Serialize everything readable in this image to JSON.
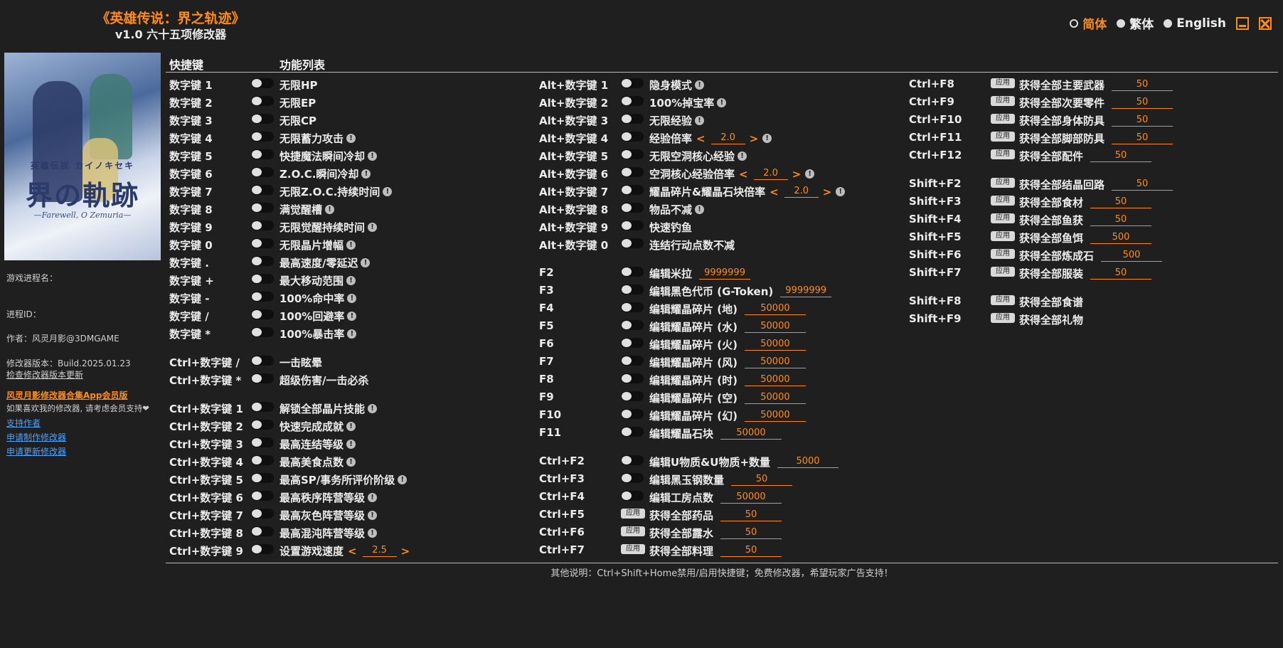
{
  "title": {
    "game": "《英雄传说：界之轨迹》",
    "version": "v1.0 六十五项修改器"
  },
  "languages": [
    {
      "label": "简体",
      "active": true
    },
    {
      "label": "繁体",
      "active": false
    },
    {
      "label": "English",
      "active": false
    }
  ],
  "cover": {
    "logo": "界の軌跡",
    "top": "英雄伝説 カイノキセキ",
    "subtitle": "—Farewell, O Zemuria—"
  },
  "sidebar": {
    "process_name_label": "游戏进程名：",
    "process_id_label": "进程ID：",
    "author": "作者：风灵月影@3DMGAME",
    "version": "修改器版本：Build.2025.01.23",
    "check_update": "检查修改器版本更新",
    "vip": "风灵月影修改器合集App会员版",
    "support_text": "如果喜欢我的修改器, 请考虑会员支持❤",
    "support_author": "支持作者",
    "request_make": "申请制作修改器",
    "request_update": "申请更新修改器"
  },
  "headers": {
    "hotkey": "快捷键",
    "features": "功能列表"
  },
  "col1": [
    {
      "key": "数字键 1",
      "label": "无限HP",
      "warn": false
    },
    {
      "key": "数字键 2",
      "label": "无限EP",
      "warn": false
    },
    {
      "key": "数字键 3",
      "label": "无限CP",
      "warn": false
    },
    {
      "key": "数字键 4",
      "label": "无限蓄力攻击",
      "warn": true
    },
    {
      "key": "数字键 5",
      "label": "快捷魔法瞬间冷却",
      "warn": true
    },
    {
      "key": "数字键 6",
      "label": "Z.O.C.瞬间冷却",
      "warn": true
    },
    {
      "key": "数字键 7",
      "label": "无限Z.O.C.持续时间",
      "warn": true
    },
    {
      "key": "数字键 8",
      "label": "满觉醒槽",
      "warn": true
    },
    {
      "key": "数字键 9",
      "label": "无限觉醒持续时间",
      "warn": true
    },
    {
      "key": "数字键 0",
      "label": "无限晶片增幅",
      "warn": true
    },
    {
      "key": "数字键 .",
      "label": "最高速度/零延迟",
      "warn": true
    },
    {
      "key": "数字键 +",
      "label": "最大移动范围",
      "warn": true
    },
    {
      "key": "数字键 -",
      "label": "100%命中率",
      "warn": true
    },
    {
      "key": "数字键 /",
      "label": "100%回避率",
      "warn": true
    },
    {
      "key": "数字键 *",
      "label": "100%暴击率",
      "warn": true
    },
    {
      "key": "Ctrl+数字键 /",
      "label": "一击眩晕",
      "warn": false,
      "gap": true
    },
    {
      "key": "Ctrl+数字键 *",
      "label": "超级伤害/一击必杀",
      "warn": false
    },
    {
      "key": "Ctrl+数字键 1",
      "label": "解锁全部晶片技能",
      "warn": true,
      "gap": true
    },
    {
      "key": "Ctrl+数字键 2",
      "label": "快速完成成就",
      "warn": true
    },
    {
      "key": "Ctrl+数字键 3",
      "label": "最高连结等级",
      "warn": true
    },
    {
      "key": "Ctrl+数字键 4",
      "label": "最高美食点数",
      "warn": true
    },
    {
      "key": "Ctrl+数字键 5",
      "label": "最高SP/事务所评价阶级",
      "warn": true
    },
    {
      "key": "Ctrl+数字键 6",
      "label": "最高秩序阵营等级",
      "warn": true
    },
    {
      "key": "Ctrl+数字键 7",
      "label": "最高灰色阵营等级",
      "warn": true
    },
    {
      "key": "Ctrl+数字键 8",
      "label": "最高混沌阵营等级",
      "warn": true
    },
    {
      "key": "Ctrl+数字键 9",
      "label": "设置游戏速度",
      "warn": false,
      "stepper": "2.5"
    }
  ],
  "col2": [
    {
      "key": "Alt+数字键 1",
      "label": "隐身模式",
      "warn": true
    },
    {
      "key": "Alt+数字键 2",
      "label": "100%掉宝率",
      "warn": true
    },
    {
      "key": "Alt+数字键 3",
      "label": "无限经验",
      "warn": true
    },
    {
      "key": "Alt+数字键 4",
      "label": "经验倍率",
      "warn": true,
      "stepper": "2.0"
    },
    {
      "key": "Alt+数字键 5",
      "label": "无限空洞核心经验",
      "warn": true
    },
    {
      "key": "Alt+数字键 6",
      "label": "空洞核心经验倍率",
      "warn": true,
      "stepper": "2.0"
    },
    {
      "key": "Alt+数字键 7",
      "label": "耀晶碎片&耀晶石块倍率",
      "warn": true,
      "stepper": "2.0"
    },
    {
      "key": "Alt+数字键 8",
      "label": "物品不减",
      "warn": true
    },
    {
      "key": "Alt+数字键 9",
      "label": "快速钓鱼",
      "warn": false
    },
    {
      "key": "Alt+数字键 0",
      "label": "连结行动点数不减",
      "warn": false
    },
    {
      "key": "F2",
      "label": "编辑米拉",
      "value": "9999999",
      "gap": true
    },
    {
      "key": "F3",
      "label": "编辑黑色代币 (G-Token)",
      "value": "9999999"
    },
    {
      "key": "F4",
      "label": "编辑耀晶碎片 (地)",
      "value": "50000"
    },
    {
      "key": "F5",
      "label": "编辑耀晶碎片 (水)",
      "value": "50000"
    },
    {
      "key": "F6",
      "label": "编辑耀晶碎片 (火)",
      "value": "50000"
    },
    {
      "key": "F7",
      "label": "编辑耀晶碎片 (风)",
      "value": "50000"
    },
    {
      "key": "F8",
      "label": "编辑耀晶碎片 (时)",
      "value": "50000"
    },
    {
      "key": "F9",
      "label": "编辑耀晶碎片 (空)",
      "value": "50000"
    },
    {
      "key": "F10",
      "label": "编辑耀晶碎片 (幻)",
      "value": "50000"
    },
    {
      "key": "F11",
      "label": "编辑耀晶石块",
      "value": "50000"
    },
    {
      "key": "Ctrl+F2",
      "label": "编辑U物质&U物质+数量",
      "value": "5000",
      "gap": true
    },
    {
      "key": "Ctrl+F3",
      "label": "编辑黑玉钢数量",
      "value": "50"
    },
    {
      "key": "Ctrl+F4",
      "label": "编辑工房点数",
      "value": "50000"
    },
    {
      "key": "Ctrl+F5",
      "label": "获得全部药品",
      "value": "50",
      "apply": true
    },
    {
      "key": "Ctrl+F6",
      "label": "获得全部露水",
      "value": "50",
      "apply": true
    },
    {
      "key": "Ctrl+F7",
      "label": "获得全部料理",
      "value": "50",
      "apply": true
    }
  ],
  "col3": [
    {
      "key": "Ctrl+F8",
      "label": "获得全部主要武器",
      "value": "50"
    },
    {
      "key": "Ctrl+F9",
      "label": "获得全部次要零件",
      "value": "50"
    },
    {
      "key": "Ctrl+F10",
      "label": "获得全部身体防具",
      "value": "50"
    },
    {
      "key": "Ctrl+F11",
      "label": "获得全部脚部防具",
      "value": "50"
    },
    {
      "key": "Ctrl+F12",
      "label": "获得全部配件",
      "value": "50"
    },
    {
      "key": "Shift+F2",
      "label": "获得全部结晶回路",
      "value": "50",
      "gap": true
    },
    {
      "key": "Shift+F3",
      "label": "获得全部食材",
      "value": "50"
    },
    {
      "key": "Shift+F4",
      "label": "获得全部鱼获",
      "value": "50"
    },
    {
      "key": "Shift+F5",
      "label": "获得全部鱼饵",
      "value": "500"
    },
    {
      "key": "Shift+F6",
      "label": "获得全部炼成石",
      "value": "500"
    },
    {
      "key": "Shift+F7",
      "label": "获得全部服装",
      "value": "50"
    },
    {
      "key": "Shift+F8",
      "label": "获得全部食谱",
      "gap": true
    },
    {
      "key": "Shift+F9",
      "label": "获得全部礼物"
    }
  ],
  "apply_label": "应用",
  "footer": "其他说明：Ctrl+Shift+Home禁用/启用快捷键；免费修改器，希望玩家广告支持！",
  "colors": {
    "accent": "#ff8c1a",
    "background": "#1f1f1f",
    "link": "#4aa3ff"
  }
}
